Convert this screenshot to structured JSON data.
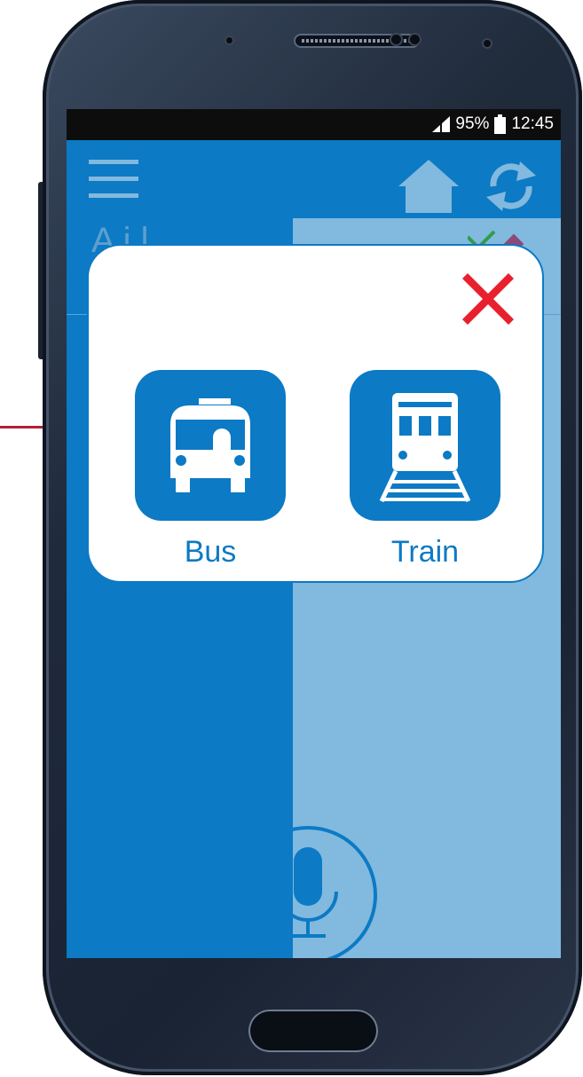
{
  "status_bar": {
    "battery": "95%",
    "time": "12:45"
  },
  "header": {
    "menu_icon": "hamburger-icon",
    "home_icon": "home-icon",
    "refresh_icon": "refresh-icon"
  },
  "content": {
    "title": "A  i  l"
  },
  "dialog": {
    "close_icon": "close-x-icon",
    "options": [
      {
        "label": "Bus",
        "icon": "bus-icon"
      },
      {
        "label": "Train",
        "icon": "train-icon"
      }
    ]
  },
  "footer": {
    "mic_icon": "microphone-icon"
  },
  "colors": {
    "primary": "#0c7ac4",
    "light_panel": "#82b9de",
    "close": "#e8202e",
    "annotation_line": "#b3203a"
  }
}
